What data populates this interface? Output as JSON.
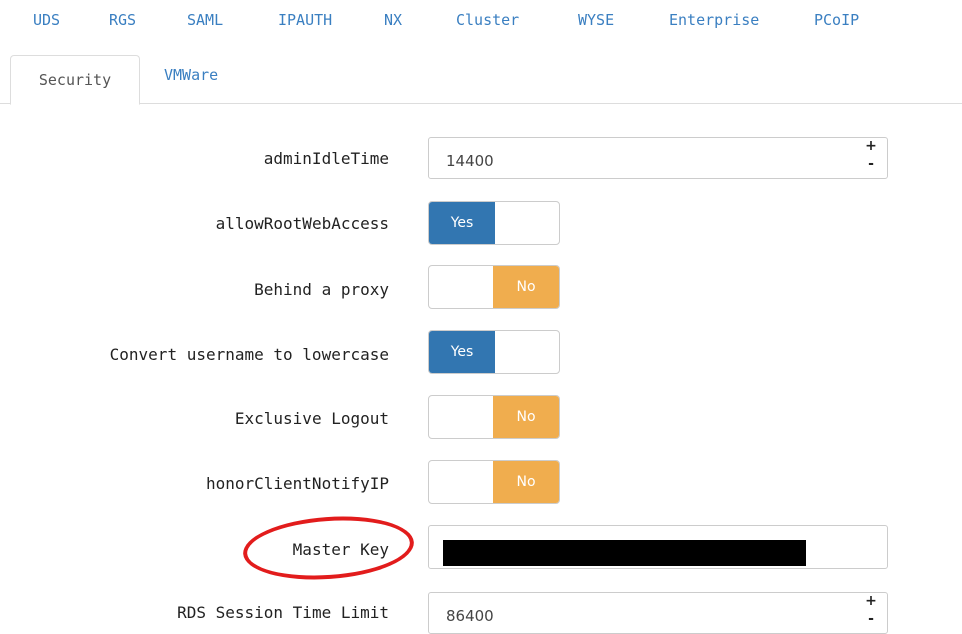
{
  "tabs": {
    "row1": [
      "UDS",
      "RGS",
      "SAML",
      "IPAUTH",
      "NX",
      "Cluster",
      "WYSE",
      "Enterprise",
      "PCoIP"
    ],
    "active": "Security",
    "second": "VMWare"
  },
  "fields": {
    "admin_idle_time": {
      "label": "adminIdleTime",
      "value": "14400"
    },
    "allow_root_web_access": {
      "label": "allowRootWebAccess",
      "state": "Yes"
    },
    "behind_a_proxy": {
      "label": "Behind a proxy",
      "state": "No"
    },
    "convert_username": {
      "label": "Convert username to lowercase",
      "state": "Yes"
    },
    "exclusive_logout": {
      "label": "Exclusive Logout",
      "state": "No"
    },
    "honor_client_notify_ip": {
      "label": "honorClientNotifyIP",
      "state": "No"
    },
    "master_key": {
      "label": "Master Key",
      "value": ""
    },
    "rds_session_time_limit": {
      "label": "RDS Session Time Limit",
      "value": "86400"
    }
  },
  "stepper": {
    "plus": "+",
    "minus": "-"
  },
  "colors": {
    "accent_blue": "#3276b1",
    "warn_orange": "#f0ad4e",
    "link_blue": "#3a7fc1",
    "annotation_red": "#e21c1c"
  }
}
